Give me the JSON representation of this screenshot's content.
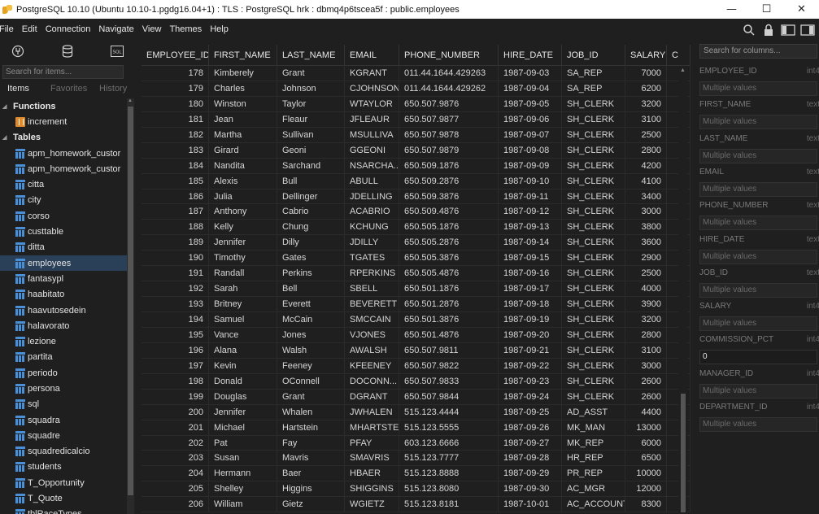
{
  "window": {
    "title": "PostgreSQL 10.10 (Ubuntu 10.10-1.pgdg16.04+1) : TLS : PostgreSQL hrk : dbmq4p6tscea5f : public.employees",
    "minimize": "—",
    "maximize": "☐",
    "close": "✕"
  },
  "menu": [
    "File",
    "Edit",
    "Connection",
    "Navigate",
    "View",
    "Themes",
    "Help"
  ],
  "sidebar": {
    "search_placeholder": "Search for items...",
    "tabs": [
      "Items",
      "Favorites",
      "History"
    ],
    "functions_label": "Functions",
    "functions": [
      "increment"
    ],
    "tables_label": "Tables",
    "tables": [
      "apm_homework_custor",
      "apm_homework_custor",
      "citta",
      "city",
      "corso",
      "custtable",
      "ditta",
      "employees",
      "fantasypl",
      "haabitato",
      "haavutosedein",
      "halavorato",
      "lezione",
      "partita",
      "periodo",
      "persona",
      "sql",
      "squadra",
      "squadre",
      "squadredicalcio",
      "students",
      "T_Opportunity",
      "T_Quote",
      "tblRaceTypes"
    ],
    "selected_table": "employees"
  },
  "grid": {
    "columns": [
      "EMPLOYEE_ID",
      "FIRST_NAME",
      "LAST_NAME",
      "EMAIL",
      "PHONE_NUMBER",
      "HIRE_DATE",
      "JOB_ID",
      "SALARY",
      "C"
    ],
    "rows": [
      [
        "178",
        "Kimberely",
        "Grant",
        "KGRANT",
        "011.44.1644.429263",
        "1987-09-03",
        "SA_REP",
        "7000"
      ],
      [
        "179",
        "Charles",
        "Johnson",
        "CJOHNSON",
        "011.44.1644.429262",
        "1987-09-04",
        "SA_REP",
        "6200"
      ],
      [
        "180",
        "Winston",
        "Taylor",
        "WTAYLOR",
        "650.507.9876",
        "1987-09-05",
        "SH_CLERK",
        "3200"
      ],
      [
        "181",
        "Jean",
        "Fleaur",
        "JFLEAUR",
        "650.507.9877",
        "1987-09-06",
        "SH_CLERK",
        "3100"
      ],
      [
        "182",
        "Martha",
        "Sullivan",
        "MSULLIVA",
        "650.507.9878",
        "1987-09-07",
        "SH_CLERK",
        "2500"
      ],
      [
        "183",
        "Girard",
        "Geoni",
        "GGEONI",
        "650.507.9879",
        "1987-09-08",
        "SH_CLERK",
        "2800"
      ],
      [
        "184",
        "Nandita",
        "Sarchand",
        "NSARCHA...",
        "650.509.1876",
        "1987-09-09",
        "SH_CLERK",
        "4200"
      ],
      [
        "185",
        "Alexis",
        "Bull",
        "ABULL",
        "650.509.2876",
        "1987-09-10",
        "SH_CLERK",
        "4100"
      ],
      [
        "186",
        "Julia",
        "Dellinger",
        "JDELLING",
        "650.509.3876",
        "1987-09-11",
        "SH_CLERK",
        "3400"
      ],
      [
        "187",
        "Anthony",
        "Cabrio",
        "ACABRIO",
        "650.509.4876",
        "1987-09-12",
        "SH_CLERK",
        "3000"
      ],
      [
        "188",
        "Kelly",
        "Chung",
        "KCHUNG",
        "650.505.1876",
        "1987-09-13",
        "SH_CLERK",
        "3800"
      ],
      [
        "189",
        "Jennifer",
        "Dilly",
        "JDILLY",
        "650.505.2876",
        "1987-09-14",
        "SH_CLERK",
        "3600"
      ],
      [
        "190",
        "Timothy",
        "Gates",
        "TGATES",
        "650.505.3876",
        "1987-09-15",
        "SH_CLERK",
        "2900"
      ],
      [
        "191",
        "Randall",
        "Perkins",
        "RPERKINS",
        "650.505.4876",
        "1987-09-16",
        "SH_CLERK",
        "2500"
      ],
      [
        "192",
        "Sarah",
        "Bell",
        "SBELL",
        "650.501.1876",
        "1987-09-17",
        "SH_CLERK",
        "4000"
      ],
      [
        "193",
        "Britney",
        "Everett",
        "BEVERETT",
        "650.501.2876",
        "1987-09-18",
        "SH_CLERK",
        "3900"
      ],
      [
        "194",
        "Samuel",
        "McCain",
        "SMCCAIN",
        "650.501.3876",
        "1987-09-19",
        "SH_CLERK",
        "3200"
      ],
      [
        "195",
        "Vance",
        "Jones",
        "VJONES",
        "650.501.4876",
        "1987-09-20",
        "SH_CLERK",
        "2800"
      ],
      [
        "196",
        "Alana",
        "Walsh",
        "AWALSH",
        "650.507.9811",
        "1987-09-21",
        "SH_CLERK",
        "3100"
      ],
      [
        "197",
        "Kevin",
        "Feeney",
        "KFEENEY",
        "650.507.9822",
        "1987-09-22",
        "SH_CLERK",
        "3000"
      ],
      [
        "198",
        "Donald",
        "OConnell",
        "DOCONN...",
        "650.507.9833",
        "1987-09-23",
        "SH_CLERK",
        "2600"
      ],
      [
        "199",
        "Douglas",
        "Grant",
        "DGRANT",
        "650.507.9844",
        "1987-09-24",
        "SH_CLERK",
        "2600"
      ],
      [
        "200",
        "Jennifer",
        "Whalen",
        "JWHALEN",
        "515.123.4444",
        "1987-09-25",
        "AD_ASST",
        "4400"
      ],
      [
        "201",
        "Michael",
        "Hartstein",
        "MHARTSTE",
        "515.123.5555",
        "1987-09-26",
        "MK_MAN",
        "13000"
      ],
      [
        "202",
        "Pat",
        "Fay",
        "PFAY",
        "603.123.6666",
        "1987-09-27",
        "MK_REP",
        "6000"
      ],
      [
        "203",
        "Susan",
        "Mavris",
        "SMAVRIS",
        "515.123.7777",
        "1987-09-28",
        "HR_REP",
        "6500"
      ],
      [
        "204",
        "Hermann",
        "Baer",
        "HBAER",
        "515.123.8888",
        "1987-09-29",
        "PR_REP",
        "10000"
      ],
      [
        "205",
        "Shelley",
        "Higgins",
        "SHIGGINS",
        "515.123.8080",
        "1987-09-30",
        "AC_MGR",
        "12000"
      ],
      [
        "206",
        "William",
        "Gietz",
        "WGIETZ",
        "515.123.8181",
        "1987-10-01",
        "AC_ACCOUNT",
        "8300"
      ]
    ]
  },
  "filters": {
    "search_placeholder": "Search for columns...",
    "columns": [
      {
        "name": "EMPLOYEE_ID",
        "type": "int4",
        "value": "",
        "placeholder": "Multiple values"
      },
      {
        "name": "FIRST_NAME",
        "type": "text",
        "value": "",
        "placeholder": "Multiple values"
      },
      {
        "name": "LAST_NAME",
        "type": "text",
        "value": "",
        "placeholder": "Multiple values"
      },
      {
        "name": "EMAIL",
        "type": "text",
        "value": "",
        "placeholder": "Multiple values"
      },
      {
        "name": "PHONE_NUMBER",
        "type": "text",
        "value": "",
        "placeholder": "Multiple values"
      },
      {
        "name": "HIRE_DATE",
        "type": "text",
        "value": "",
        "placeholder": "Multiple values"
      },
      {
        "name": "JOB_ID",
        "type": "text",
        "value": "",
        "placeholder": "Multiple values"
      },
      {
        "name": "SALARY",
        "type": "int4",
        "value": "",
        "placeholder": "Multiple values"
      },
      {
        "name": "COMMISSION_PCT",
        "type": "int4",
        "value": "0",
        "placeholder": ""
      },
      {
        "name": "MANAGER_ID",
        "type": "int4",
        "value": "",
        "placeholder": "Multiple values"
      },
      {
        "name": "DEPARTMENT_ID",
        "type": "int4",
        "value": "",
        "placeholder": "Multiple values"
      }
    ]
  },
  "icons": {
    "search": "search-icon",
    "lock": "lock-icon",
    "panel_left": "panel-left-icon",
    "panel_right": "panel-right-icon"
  },
  "colors": {
    "selection": "#2a3f58",
    "table_icon": "#4a90d9",
    "function_icon": "#e08a2e"
  }
}
